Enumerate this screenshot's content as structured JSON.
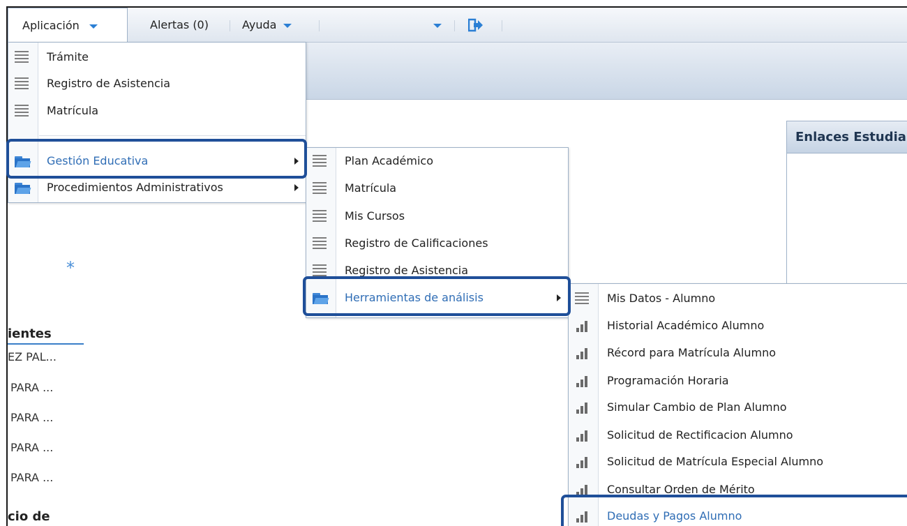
{
  "topbar": {
    "application_label": "Aplicación",
    "alerts_label": "Alertas (0)",
    "help_label": "Ayuda"
  },
  "app_menu": {
    "items": [
      {
        "label": "Trámite",
        "icon": "list-icon"
      },
      {
        "label": "Registro de Asistencia",
        "icon": "list-icon"
      },
      {
        "label": "Matrícula",
        "icon": "list-icon"
      },
      {
        "label": "Gestión Educativa",
        "icon": "folder-icon",
        "has_submenu": true,
        "selected": true
      },
      {
        "label": "Procedimientos Administrativos",
        "icon": "folder-icon",
        "has_submenu": true
      }
    ]
  },
  "gestion_menu": {
    "items": [
      {
        "label": "Plan Académico",
        "icon": "list-icon"
      },
      {
        "label": "Matrícula",
        "icon": "list-icon"
      },
      {
        "label": "Mis Cursos",
        "icon": "list-icon"
      },
      {
        "label": "Registro de Calificaciones",
        "icon": "list-icon"
      },
      {
        "label": "Registro de Asistencia",
        "icon": "list-icon"
      },
      {
        "label": "Herramientas de análisis",
        "icon": "folder-icon",
        "has_submenu": true,
        "selected": true
      }
    ]
  },
  "herramientas_menu": {
    "items": [
      {
        "label": "Mis Datos - Alumno",
        "icon": "list-icon"
      },
      {
        "label": "Historial Académico Alumno",
        "icon": "bar-chart-icon"
      },
      {
        "label": "Récord para Matrícula Alumno",
        "icon": "bar-chart-icon"
      },
      {
        "label": "Programación Horaria",
        "icon": "bar-chart-icon"
      },
      {
        "label": "Simular Cambio de Plan Alumno",
        "icon": "bar-chart-icon"
      },
      {
        "label": "Solicitud de Rectificacion Alumno",
        "icon": "bar-chart-icon"
      },
      {
        "label": "Solicitud de Matrícula Especial Alumno",
        "icon": "bar-chart-icon"
      },
      {
        "label": "Consultar Orden de Mérito",
        "icon": "bar-chart-icon"
      },
      {
        "label": "Deudas y Pagos Alumno",
        "icon": "bar-chart-icon",
        "selected": true
      }
    ]
  },
  "background": {
    "heading": "ientes",
    "rows": [
      "EZ PAL...",
      "PARA ...",
      "PARA ...",
      "PARA ...",
      "PARA ..."
    ],
    "heading2": "cio de",
    "enlaces_title": "Enlaces Estudiante"
  },
  "colors": {
    "highlight_border": "#1f4f99",
    "accent": "#2b7fd4",
    "selected_text": "#2f6db5"
  }
}
